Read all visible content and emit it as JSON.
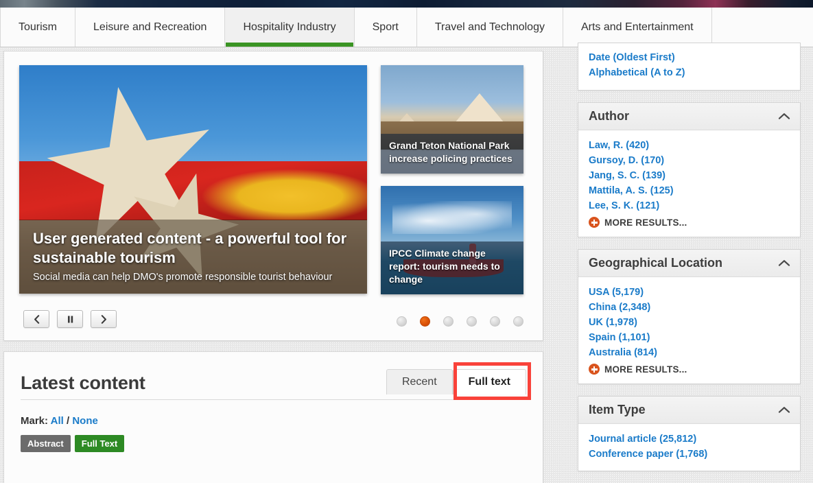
{
  "banner": {
    "name": "site-banner-image"
  },
  "tabs": [
    {
      "label": "Tourism",
      "active": false
    },
    {
      "label": "Leisure and Recreation",
      "active": false
    },
    {
      "label": "Hospitality Industry",
      "active": true
    },
    {
      "label": "Sport",
      "active": false
    },
    {
      "label": "Travel and Technology",
      "active": false
    },
    {
      "label": "Arts and Entertainment",
      "active": false
    }
  ],
  "carousel": {
    "hero": {
      "title": "User generated content - a powerful tool for sustainable tourism",
      "subtitle": "Social media can help DMO's promote responsible tourist behaviour"
    },
    "thumbnails": [
      {
        "title": "Grand Teton National Park increase policing practices"
      },
      {
        "title": "IPCC Climate change report: tourism needs to change"
      }
    ],
    "controls": {
      "previous": "‹",
      "pause": "‖",
      "next": "›"
    },
    "dots_total": 6,
    "dot_active_index": 1
  },
  "latest": {
    "title": "Latest content",
    "tabs": [
      {
        "label": "Recent",
        "active": false
      },
      {
        "label": "Full text",
        "active": true,
        "highlighted": true
      }
    ],
    "mark_label": "Mark:",
    "mark_all": "All",
    "mark_sep": "/",
    "mark_none": "None",
    "badges": [
      {
        "label": "Abstract",
        "color": "#6b6b6b"
      },
      {
        "label": "Full Text",
        "color": "#2d8a24"
      }
    ]
  },
  "sidebar": {
    "sort_panel": {
      "links": [
        "Date (Oldest First)",
        "Alphabetical (A to Z)"
      ]
    },
    "facets": [
      {
        "title": "Author",
        "collapse_icon": "chevron-up-icon",
        "items": [
          "Law, R. (420)",
          "Gursoy, D. (170)",
          "Jang,  S. C. (139)",
          "Mattila, A. S. (125)",
          "Lee, S. K. (121)"
        ],
        "more_label": "MORE RESULTS..."
      },
      {
        "title": "Geographical Location",
        "collapse_icon": "chevron-up-icon",
        "items": [
          "USA (5,179)",
          "China (2,348)",
          "UK (1,978)",
          "Spain (1,101)",
          "Australia (814)"
        ],
        "more_label": "MORE RESULTS..."
      },
      {
        "title": "Item Type",
        "collapse_icon": "chevron-up-icon",
        "items": [
          "Journal article (25,812)",
          "Conference paper (1,768)"
        ],
        "more_label": ""
      }
    ]
  },
  "colors": {
    "accent_green": "#3a9423",
    "link_blue": "#1a7bc9",
    "highlight_red": "#f9423a",
    "dot_active_orange": "#d94f05",
    "badge_grey": "#6b6b6b",
    "badge_green": "#2d8a24"
  }
}
